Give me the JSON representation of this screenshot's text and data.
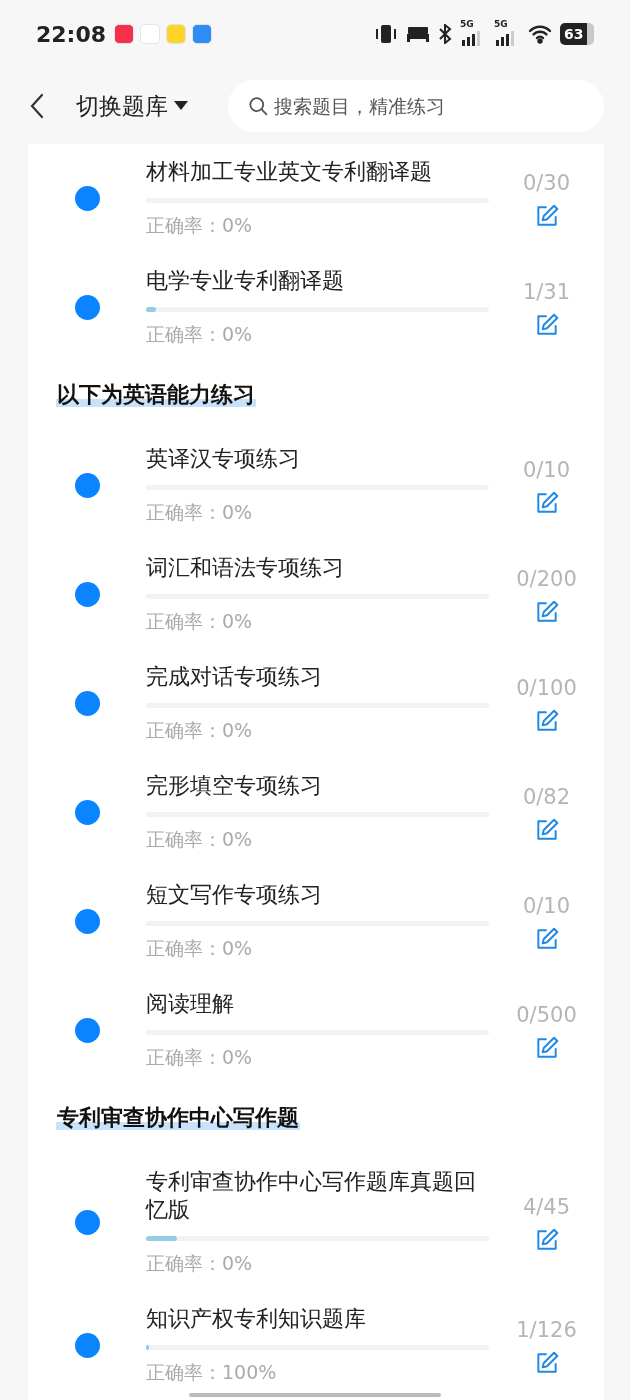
{
  "status_bar": {
    "time": "22:08",
    "signal_labels": [
      "5G",
      "5G"
    ],
    "battery": "63"
  },
  "header": {
    "title": "切换题库",
    "search": {
      "placeholder": "搜索题目，精准练习"
    }
  },
  "sections": [
    {
      "items": [
        {
          "title": "材料加工专业英文专利翻译题",
          "count": "0/30",
          "accuracy": "正确率：0%"
        },
        {
          "title": "电学专业专利翻译题",
          "level": 0.03,
          "count": "1/31",
          "accuracy": "正确率：0%"
        }
      ]
    },
    {
      "heading": "以下为英语能力练习",
      "items": [
        {
          "title": "英译汉专项练习",
          "count": "0/10",
          "accuracy": "正确率：0%"
        },
        {
          "title": "词汇和语法专项练习",
          "count": "0/200",
          "accuracy": "正确率：0%"
        },
        {
          "title": "完成对话专项练习",
          "count": "0/100",
          "accuracy": "正确率：0%"
        },
        {
          "title": "完形填空专项练习",
          "count": "0/82",
          "accuracy": "正确率：0%"
        },
        {
          "title": "短文写作专项练习",
          "count": "0/10",
          "accuracy": "正确率：0%"
        },
        {
          "title": "阅读理解",
          "count": "0/500",
          "accuracy": "正确率：0%"
        }
      ]
    },
    {
      "heading": "专利审查协作中心写作题",
      "items": [
        {
          "title": "专利审查协作中心写作题库真题回忆版",
          "level": 0.09,
          "count": "4/45",
          "accuracy": "正确率：0%"
        },
        {
          "title": "知识产权专利知识题库",
          "level": 0.01,
          "count": "1/126",
          "accuracy": "正确率：100%"
        }
      ]
    }
  ]
}
